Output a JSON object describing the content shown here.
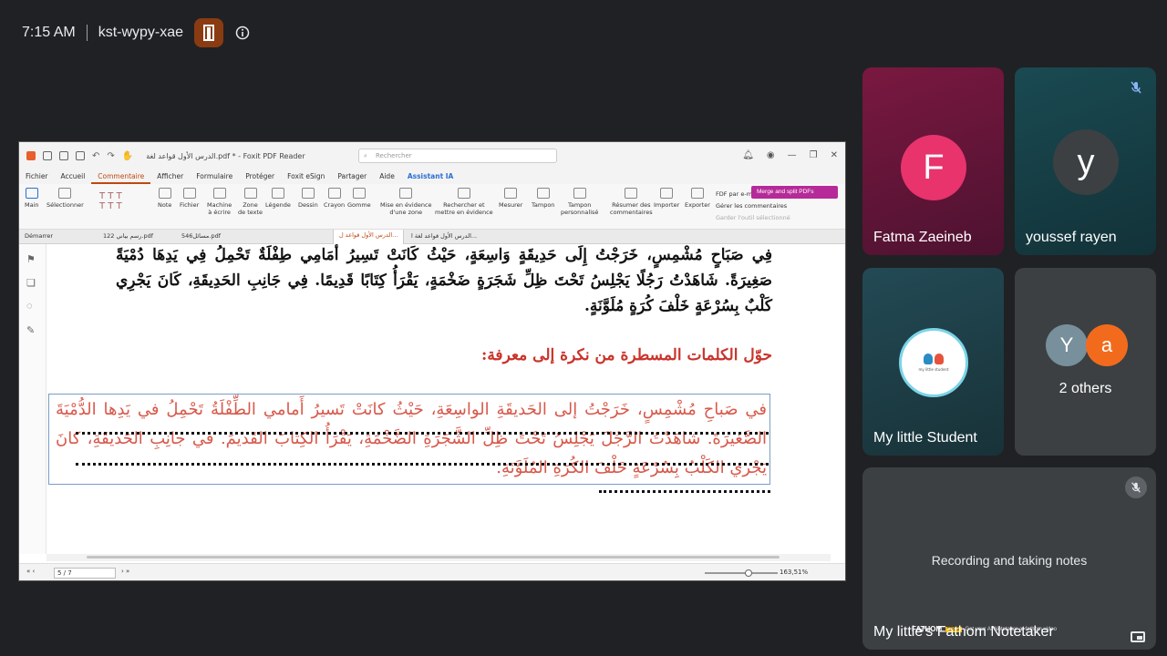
{
  "meeting": {
    "time": "7:15 AM",
    "code": "kst-wypy-xae"
  },
  "shared_screen": {
    "app_title": "الدرس الأول قواعد لغة.pdf * - Foxit PDF Reader",
    "search_placeholder": "Rechercher",
    "menu": [
      "Fichier",
      "Accueil",
      "Commentaire",
      "Afficher",
      "Formulaire",
      "Protéger",
      "Foxit eSign",
      "Partager",
      "Aide",
      "Assistant IA"
    ],
    "ribbon": {
      "main": "Main",
      "select": "Sélectionner",
      "note": "Note",
      "file": "Fichier",
      "typewriter_1": "Machine",
      "typewriter_2": "à écrire",
      "textbox_1": "Zone",
      "textbox_2": "de texte",
      "callout": "Légende",
      "drawing": "Dessin",
      "pencil": "Crayon",
      "eraser": "Gomme",
      "highlight_1": "Mise en évidence",
      "highlight_2": "d'une zone",
      "search_highlight_1": "Rechercher et",
      "search_highlight_2": "mettre en évidence",
      "measure": "Mesurer",
      "stamp": "Tampon",
      "custom_stamp_1": "Tampon",
      "custom_stamp_2": "personnalisé",
      "summary_1": "Résumer des",
      "summary_2": "commentaires",
      "import": "Importer",
      "export": "Exporter",
      "fdf_mail": "FDF par e-mail",
      "manage_comments": "Gérer les commentaires",
      "keep_tool": "Garder l'outil sélectionné"
    },
    "merge_button": "Merge and split PDFs",
    "tabs": {
      "start": "Démarrer",
      "tab1": "رسم بياني 122.pdf",
      "tab2": "مسائل546.pdf",
      "tab3": "الدرس الأول قواعد ل...",
      "tab4": "الدرس الأول قواعد لغة ا..."
    },
    "doc": {
      "paragraph_top": "فِي صَبَاحٍ مُشْمِسٍ، خَرَجْتُ إِلَى حَدِيقَةٍ وَاسِعَةٍ، حَيْثُ كَانَتْ تَسِيرُ أَمَامِي طِفْلَةٌ تَحْمِلُ فِي يَدِهَا دُمْيَةً صَغِيرَةً. شَاهَدْتُ رَجُلًا يَجْلِسُ تَحْتَ ظِلِّ شَجَرَةٍ ضَخْمَةٍ، يَقْرَأُ كِتَابًا قَدِيمًا. فِي جَانِبِ الحَدِيقَةِ، كَانَ يَجْرِي كَلْبٌ بِسُرْعَةٍ خَلْفَ كُرَةٍ مُلَوَّنَةٍ.",
      "heading": "حوّل الكلمات المسطرة  من نكرة إلى معرفة:",
      "answer": "في صَباحِ مُشْمِسٍ، خَرَجْتُ إلى الحَديقَةِ الواسِعَةِ، حَيْثُ كانَتْ تَسيرُ أَمامي الطِّفْلَةُ تَحْمِلُ في يَدِها الدُّمْيَةَ الصَّغيرَةَ. شاهَدْتُ الرَّجُلَ يَجْلِسُ تَحْتَ ظِلِّ الشَّجَرَةِ الضَّخْمَةِ، يَقْرَأُ الكِتابَ القَديمَ. في جانِبِ الحَديقَةِ، كانَ يَجْري الكَلْبُ بِسُرْعَةٍ خَلْفَ الكُرَةِ المُلَوَّنَةِ."
    },
    "status": {
      "page": "5 / 7",
      "zoom": "163,51%"
    }
  },
  "participants": [
    {
      "name": "Fatma Zaeineb",
      "initial": "F",
      "color": "#e8336d"
    },
    {
      "name": "youssef rayen",
      "initial": "y",
      "color": "#3c4043",
      "muted": true
    },
    {
      "name": "My little Student",
      "logo_text": "my little student"
    },
    {
      "name": "2 others",
      "initials": [
        "Y",
        "a"
      ],
      "colors": [
        "#78909c",
        "#f26b1d"
      ]
    },
    {
      "name": "My little's Fathom Notetaker",
      "status": "Recording and taking notes",
      "muted": true,
      "watermark": {
        "brand": "FATHOM",
        "badge": "FREE",
        "text": "Get your AI Notetaker at fathom.video"
      }
    }
  ],
  "colors": {
    "background": "#202124",
    "tile": "#3c4043",
    "door_button": "#8a3b12",
    "foxit_accent": "#c0480f",
    "doc_red": "#c9342b"
  }
}
